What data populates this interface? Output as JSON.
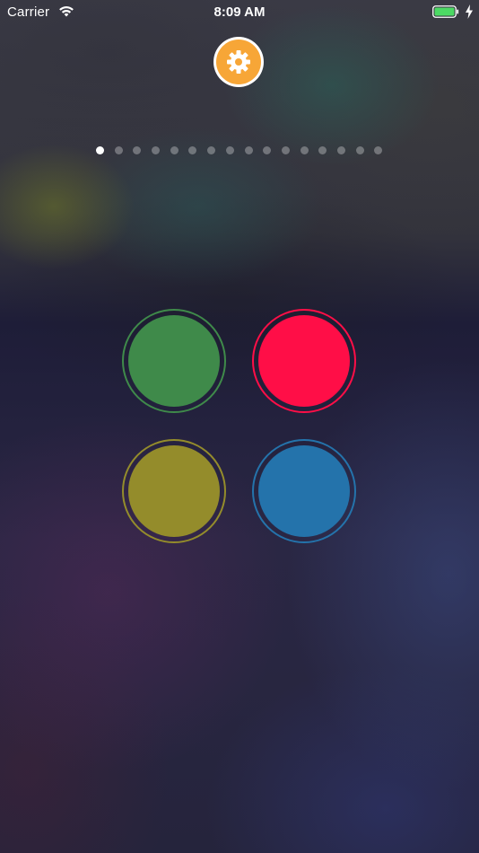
{
  "status_bar": {
    "carrier": "Carrier",
    "time": "8:09 AM",
    "icons": [
      "wifi-icon",
      "battery-icon",
      "charging-bolt-icon"
    ],
    "battery_color": "#4cd964"
  },
  "settings": {
    "icon": "gear-icon",
    "accent_color": "#f7a637"
  },
  "page_indicator": {
    "total_pages": 16,
    "current_page": 1
  },
  "pads": [
    {
      "name": "green",
      "color": "#3f8a4a"
    },
    {
      "name": "red",
      "color": "#ff0e47"
    },
    {
      "name": "yellow",
      "color": "#948c2b"
    },
    {
      "name": "blue",
      "color": "#2473ab"
    }
  ]
}
